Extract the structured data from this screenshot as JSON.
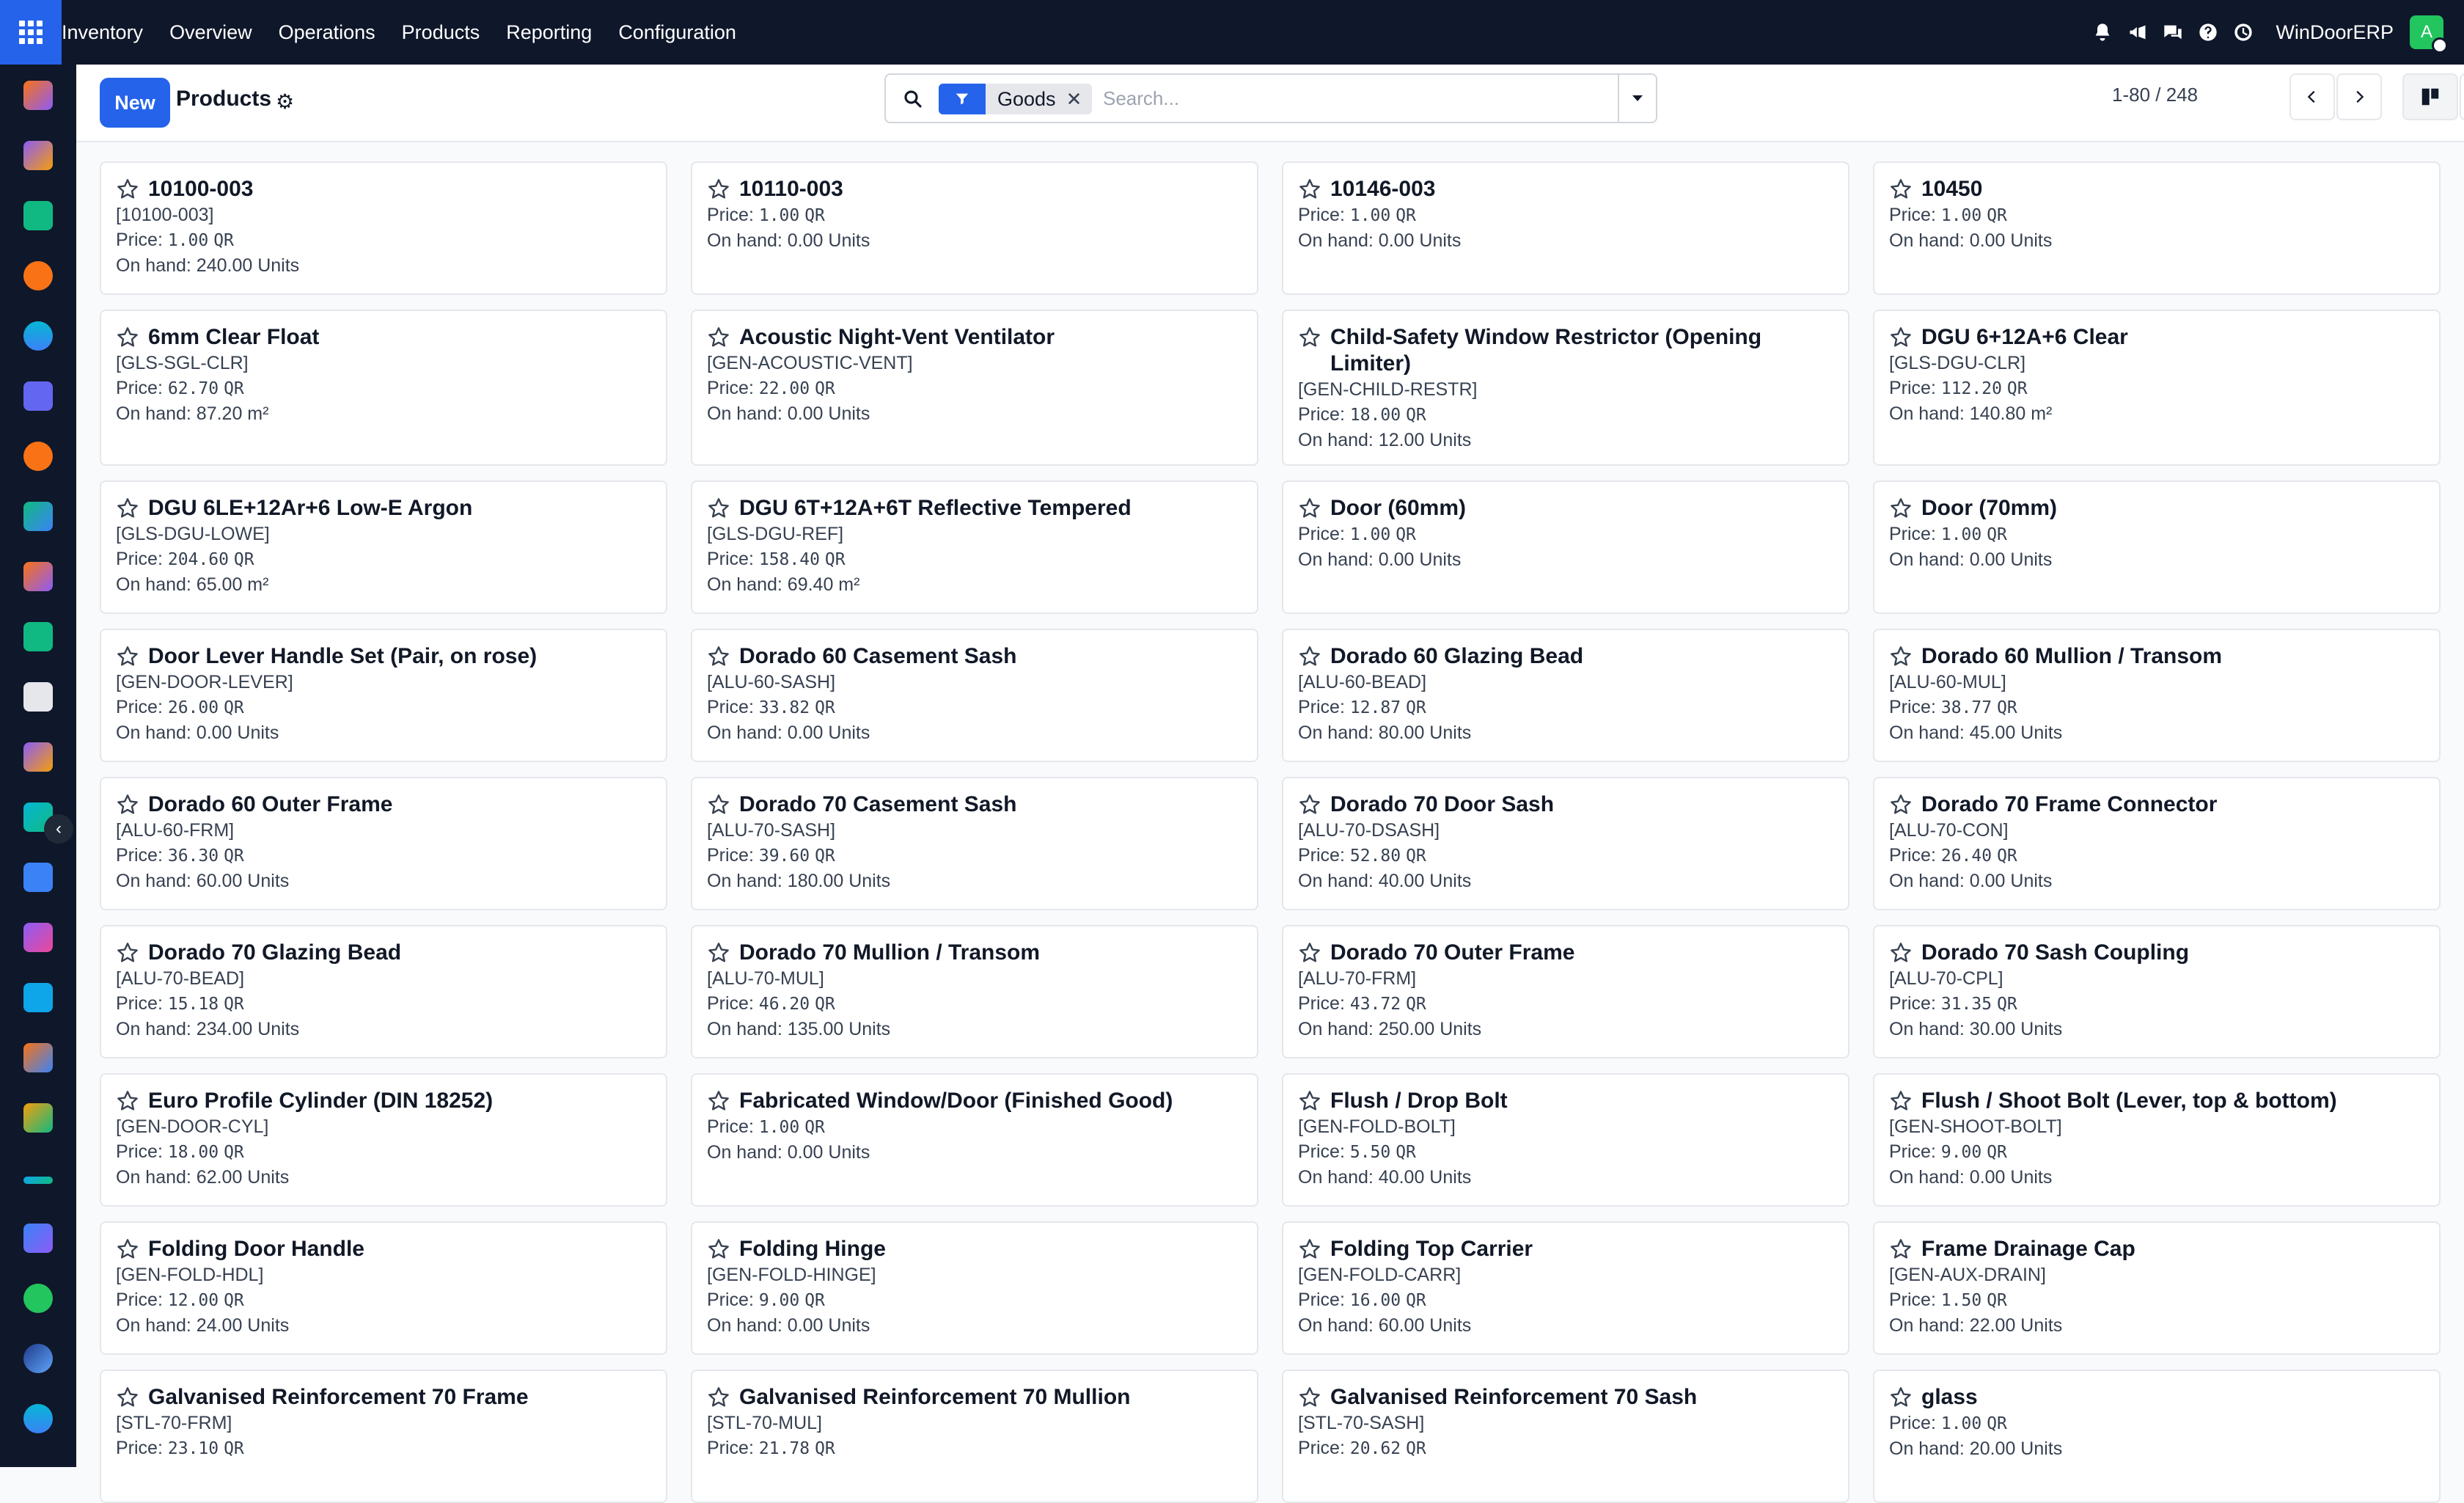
{
  "nav": {
    "app_name": "Inventory",
    "menu": [
      "Overview",
      "Operations",
      "Products",
      "Reporting",
      "Configuration"
    ],
    "company": "WinDoorERP",
    "avatar_letter": "A"
  },
  "control_panel": {
    "new_label": "New",
    "title": "Products",
    "facet_label": "Goods",
    "search_placeholder": "Search...",
    "pager": "1-80 / 248"
  },
  "colors": {
    "accent": "#2563eb",
    "topbar": "#0f172a",
    "avatar": "#22c55e"
  },
  "products": [
    {
      "name": "10100-003",
      "code": "[10100-003]",
      "price": "1.00",
      "currency": "QR",
      "on_hand": "On hand: 240.00 Units"
    },
    {
      "name": "10110-003",
      "code": "",
      "price": "1.00",
      "currency": "QR",
      "on_hand": "On hand: 0.00 Units"
    },
    {
      "name": "10146-003",
      "code": "",
      "price": "1.00",
      "currency": "QR",
      "on_hand": "On hand: 0.00 Units"
    },
    {
      "name": "10450",
      "code": "",
      "price": "1.00",
      "currency": "QR",
      "on_hand": "On hand: 0.00 Units"
    },
    {
      "name": "6mm Clear Float",
      "code": "[GLS-SGL-CLR]",
      "price": "62.70",
      "currency": "QR",
      "on_hand": "On hand: 87.20 m²"
    },
    {
      "name": "Acoustic Night-Vent Ventilator",
      "code": "[GEN-ACOUSTIC-VENT]",
      "price": "22.00",
      "currency": "QR",
      "on_hand": "On hand: 0.00 Units"
    },
    {
      "name": "Child-Safety Window Restrictor (Opening Limiter)",
      "code": "[GEN-CHILD-RESTR]",
      "price": "18.00",
      "currency": "QR",
      "on_hand": "On hand: 12.00 Units"
    },
    {
      "name": "DGU 6+12A+6 Clear",
      "code": "[GLS-DGU-CLR]",
      "price": "112.20",
      "currency": "QR",
      "on_hand": "On hand: 140.80 m²"
    },
    {
      "name": "DGU 6LE+12Ar+6 Low-E Argon",
      "code": "[GLS-DGU-LOWE]",
      "price": "204.60",
      "currency": "QR",
      "on_hand": "On hand: 65.00 m²"
    },
    {
      "name": "DGU 6T+12A+6T Reflective Tempered",
      "code": "[GLS-DGU-REF]",
      "price": "158.40",
      "currency": "QR",
      "on_hand": "On hand: 69.40 m²"
    },
    {
      "name": "Door (60mm)",
      "code": "",
      "price": "1.00",
      "currency": "QR",
      "on_hand": "On hand: 0.00 Units"
    },
    {
      "name": "Door (70mm)",
      "code": "",
      "price": "1.00",
      "currency": "QR",
      "on_hand": "On hand: 0.00 Units"
    },
    {
      "name": "Door Lever Handle Set (Pair, on rose)",
      "code": "[GEN-DOOR-LEVER]",
      "price": "26.00",
      "currency": "QR",
      "on_hand": "On hand: 0.00 Units"
    },
    {
      "name": "Dorado 60 Casement Sash",
      "code": "[ALU-60-SASH]",
      "price": "33.82",
      "currency": "QR",
      "on_hand": "On hand: 0.00 Units"
    },
    {
      "name": "Dorado 60 Glazing Bead",
      "code": "[ALU-60-BEAD]",
      "price": "12.87",
      "currency": "QR",
      "on_hand": "On hand: 80.00 Units"
    },
    {
      "name": "Dorado 60 Mullion / Transom",
      "code": "[ALU-60-MUL]",
      "price": "38.77",
      "currency": "QR",
      "on_hand": "On hand: 45.00 Units"
    },
    {
      "name": "Dorado 60 Outer Frame",
      "code": "[ALU-60-FRM]",
      "price": "36.30",
      "currency": "QR",
      "on_hand": "On hand: 60.00 Units"
    },
    {
      "name": "Dorado 70 Casement Sash",
      "code": "[ALU-70-SASH]",
      "price": "39.60",
      "currency": "QR",
      "on_hand": "On hand: 180.00 Units"
    },
    {
      "name": "Dorado 70 Door Sash",
      "code": "[ALU-70-DSASH]",
      "price": "52.80",
      "currency": "QR",
      "on_hand": "On hand: 40.00 Units"
    },
    {
      "name": "Dorado 70 Frame Connector",
      "code": "[ALU-70-CON]",
      "price": "26.40",
      "currency": "QR",
      "on_hand": "On hand: 0.00 Units"
    },
    {
      "name": "Dorado 70 Glazing Bead",
      "code": "[ALU-70-BEAD]",
      "price": "15.18",
      "currency": "QR",
      "on_hand": "On hand: 234.00 Units"
    },
    {
      "name": "Dorado 70 Mullion / Transom",
      "code": "[ALU-70-MUL]",
      "price": "46.20",
      "currency": "QR",
      "on_hand": "On hand: 135.00 Units"
    },
    {
      "name": "Dorado 70 Outer Frame",
      "code": "[ALU-70-FRM]",
      "price": "43.72",
      "currency": "QR",
      "on_hand": "On hand: 250.00 Units"
    },
    {
      "name": "Dorado 70 Sash Coupling",
      "code": "[ALU-70-CPL]",
      "price": "31.35",
      "currency": "QR",
      "on_hand": "On hand: 30.00 Units"
    },
    {
      "name": "Euro Profile Cylinder (DIN 18252)",
      "code": "[GEN-DOOR-CYL]",
      "price": "18.00",
      "currency": "QR",
      "on_hand": "On hand: 62.00 Units"
    },
    {
      "name": "Fabricated Window/Door (Finished Good)",
      "code": "",
      "price": "1.00",
      "currency": "QR",
      "on_hand": "On hand: 0.00 Units"
    },
    {
      "name": "Flush / Drop Bolt",
      "code": "[GEN-FOLD-BOLT]",
      "price": "5.50",
      "currency": "QR",
      "on_hand": "On hand: 40.00 Units"
    },
    {
      "name": "Flush / Shoot Bolt (Lever, top & bottom)",
      "code": "[GEN-SHOOT-BOLT]",
      "price": "9.00",
      "currency": "QR",
      "on_hand": "On hand: 0.00 Units"
    },
    {
      "name": "Folding Door Handle",
      "code": "[GEN-FOLD-HDL]",
      "price": "12.00",
      "currency": "QR",
      "on_hand": "On hand: 24.00 Units"
    },
    {
      "name": "Folding Hinge",
      "code": "[GEN-FOLD-HINGE]",
      "price": "9.00",
      "currency": "QR",
      "on_hand": "On hand: 0.00 Units"
    },
    {
      "name": "Folding Top Carrier",
      "code": "[GEN-FOLD-CARR]",
      "price": "16.00",
      "currency": "QR",
      "on_hand": "On hand: 60.00 Units"
    },
    {
      "name": "Frame Drainage Cap",
      "code": "[GEN-AUX-DRAIN]",
      "price": "1.50",
      "currency": "QR",
      "on_hand": "On hand: 22.00 Units"
    },
    {
      "name": "Galvanised Reinforcement 70 Frame",
      "code": "[STL-70-FRM]",
      "price": "23.10",
      "currency": "QR",
      "on_hand": ""
    },
    {
      "name": "Galvanised Reinforcement 70 Mullion",
      "code": "[STL-70-MUL]",
      "price": "21.78",
      "currency": "QR",
      "on_hand": ""
    },
    {
      "name": "Galvanised Reinforcement 70 Sash",
      "code": "[STL-70-SASH]",
      "price": "20.62",
      "currency": "QR",
      "on_hand": ""
    },
    {
      "name": "glass",
      "code": "",
      "price": "1.00",
      "currency": "QR",
      "on_hand": "On hand: 20.00 Units"
    }
  ],
  "price_prefix": "Price: "
}
